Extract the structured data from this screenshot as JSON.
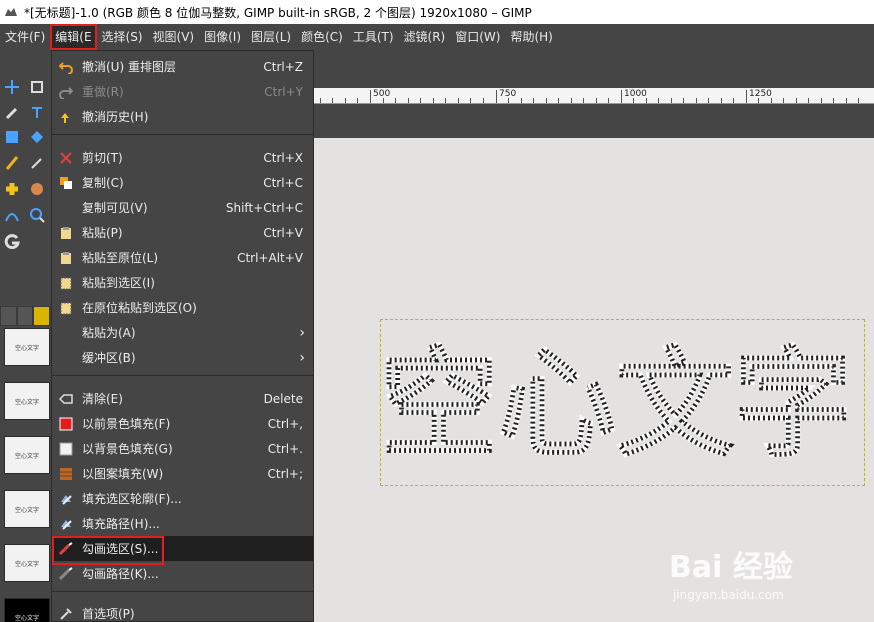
{
  "window": {
    "title": "*[无标题]-1.0 (RGB 颜色 8 位伽马整数, GIMP built-in sRGB, 2 个图层) 1920x1080 – GIMP"
  },
  "menubar": [
    {
      "label": "文件(F)"
    },
    {
      "label": "编辑(E"
    },
    {
      "label": "选择(S)"
    },
    {
      "label": "视图(V)"
    },
    {
      "label": "图像(I)"
    },
    {
      "label": "图层(L)"
    },
    {
      "label": "颜色(C)"
    },
    {
      "label": "工具(T)"
    },
    {
      "label": "滤镜(R)"
    },
    {
      "label": "窗口(W)"
    },
    {
      "label": "帮助(H)"
    }
  ],
  "edit_menu": {
    "items": [
      {
        "label": "撤消(U) 重排图层",
        "shortcut": "Ctrl+Z",
        "icon": "undo-icon"
      },
      {
        "label": "重做(R)",
        "shortcut": "Ctrl+Y",
        "icon": "redo-icon"
      },
      {
        "label": "撤消历史(H)",
        "shortcut": "",
        "icon": "undo-history-icon"
      },
      {
        "label": "剪切(T)",
        "shortcut": "Ctrl+X",
        "icon": "cut-icon"
      },
      {
        "label": "复制(C)",
        "shortcut": "Ctrl+C",
        "icon": "copy-icon"
      },
      {
        "label": "复制可见(V)",
        "shortcut": "Shift+Ctrl+C",
        "icon": ""
      },
      {
        "label": "粘贴(P)",
        "shortcut": "Ctrl+V",
        "icon": "paste-icon"
      },
      {
        "label": "粘贴至原位(L)",
        "shortcut": "Ctrl+Alt+V",
        "icon": "paste-in-place-icon"
      },
      {
        "label": "粘贴到选区(I)",
        "shortcut": "",
        "icon": "paste-into-icon"
      },
      {
        "label": "在原位粘贴到选区(O)",
        "shortcut": "",
        "icon": "paste-into-in-place-icon"
      },
      {
        "label": "粘贴为(A)",
        "shortcut": "",
        "icon": "",
        "submenu": true
      },
      {
        "label": "缓冲区(B)",
        "shortcut": "",
        "icon": "",
        "submenu": true
      },
      {
        "label": "清除(E)",
        "shortcut": "Delete",
        "icon": "clear-icon"
      },
      {
        "label": "以前景色填充(F)",
        "shortcut": "Ctrl+,",
        "icon": "fg-fill-icon"
      },
      {
        "label": "以背景色填充(G)",
        "shortcut": "Ctrl+.",
        "icon": "bg-fill-icon"
      },
      {
        "label": "以图案填充(W)",
        "shortcut": "Ctrl+;",
        "icon": "pattern-fill-icon"
      },
      {
        "label": "填充选区轮廓(F)...",
        "shortcut": "",
        "icon": "fill-selection-outline-icon"
      },
      {
        "label": "填充路径(H)...",
        "shortcut": "",
        "icon": "fill-path-icon"
      },
      {
        "label": "勾画选区(S)...",
        "shortcut": "",
        "icon": "stroke-selection-icon"
      },
      {
        "label": "勾画路径(K)...",
        "shortcut": "",
        "icon": "stroke-path-icon"
      },
      {
        "label": "首选项(P)",
        "shortcut": "",
        "icon": "preferences-icon"
      }
    ]
  },
  "ruler": {
    "labels": [
      "500",
      "750",
      "1000",
      "1250"
    ]
  },
  "thumbnails": [
    {
      "label": "空心文字"
    },
    {
      "label": "空心文字"
    },
    {
      "label": "空心文字"
    },
    {
      "label": "空心文字"
    },
    {
      "label": "空心文字"
    },
    {
      "label": "空心文字"
    }
  ],
  "canvas": {
    "text": "空心文字",
    "selection_color": "#c8b400"
  },
  "watermark": {
    "logo": "Bai 经验",
    "url": "jingyan.baidu.com"
  },
  "colors": {
    "highlight_box": "#e0201c",
    "menu_bg": "#454545",
    "canvas_bg": "#e4e2e1"
  }
}
